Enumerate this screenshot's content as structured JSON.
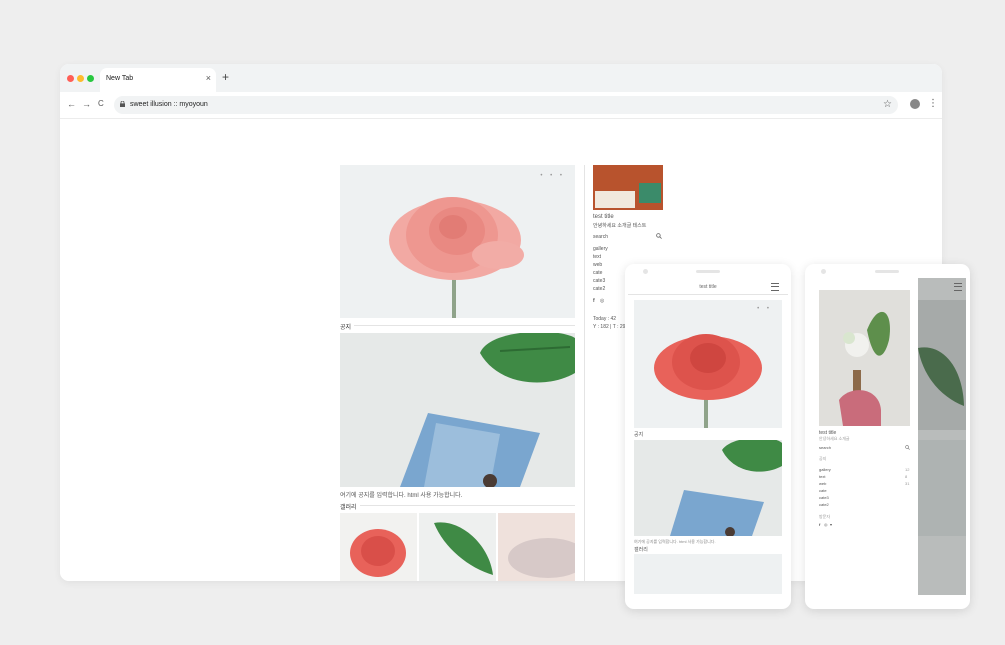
{
  "browser": {
    "tab_title": "New Tab",
    "tab_close": "×",
    "new_tab": "+",
    "url": "sweet illusion :: myoyoun",
    "back": "←",
    "forward": "→",
    "reload": "C",
    "star": "☆",
    "menu": "⋮",
    "traffic_lights": [
      "#ff5f57",
      "#febc2e",
      "#28c840"
    ]
  },
  "desktop": {
    "dots": "• • •",
    "notice_title": "공지",
    "notice_caption": "여기에 공지를 입력합니다. html 사용 가능합니다.",
    "gallery_title": "갤러리",
    "sidebar": {
      "blog_title": "test title",
      "blog_desc": "안녕하세요 소개글 테스트",
      "search_label": "search",
      "categories": [
        "gallery",
        "text",
        "web",
        "cate",
        "cate3",
        "cate2"
      ],
      "today": "Today : 42",
      "yesterday_total": "Y : 182 | T : 29"
    }
  },
  "phone1": {
    "header_title": "test title",
    "dots": "• •",
    "notice_title": "공지",
    "notice_caption": "여기에 공지를 입력합니다. html 사용 가능합니다.",
    "gallery_title": "갤러리"
  },
  "phone2": {
    "blog_title": "test title",
    "blog_desc": "안녕하세요 소개글",
    "search_label": "search",
    "section_label": "공지",
    "categories": [
      "gallery",
      "text",
      "web",
      "cate",
      "cate3",
      "cate2"
    ],
    "counts": [
      "12",
      "8",
      "31"
    ],
    "footer_label": "방문자"
  },
  "colors": {
    "rose": "#e8625a",
    "rose_pale": "#f2a9a3",
    "leaf": "#3f8a45",
    "magazine": "#7aa6cf"
  }
}
